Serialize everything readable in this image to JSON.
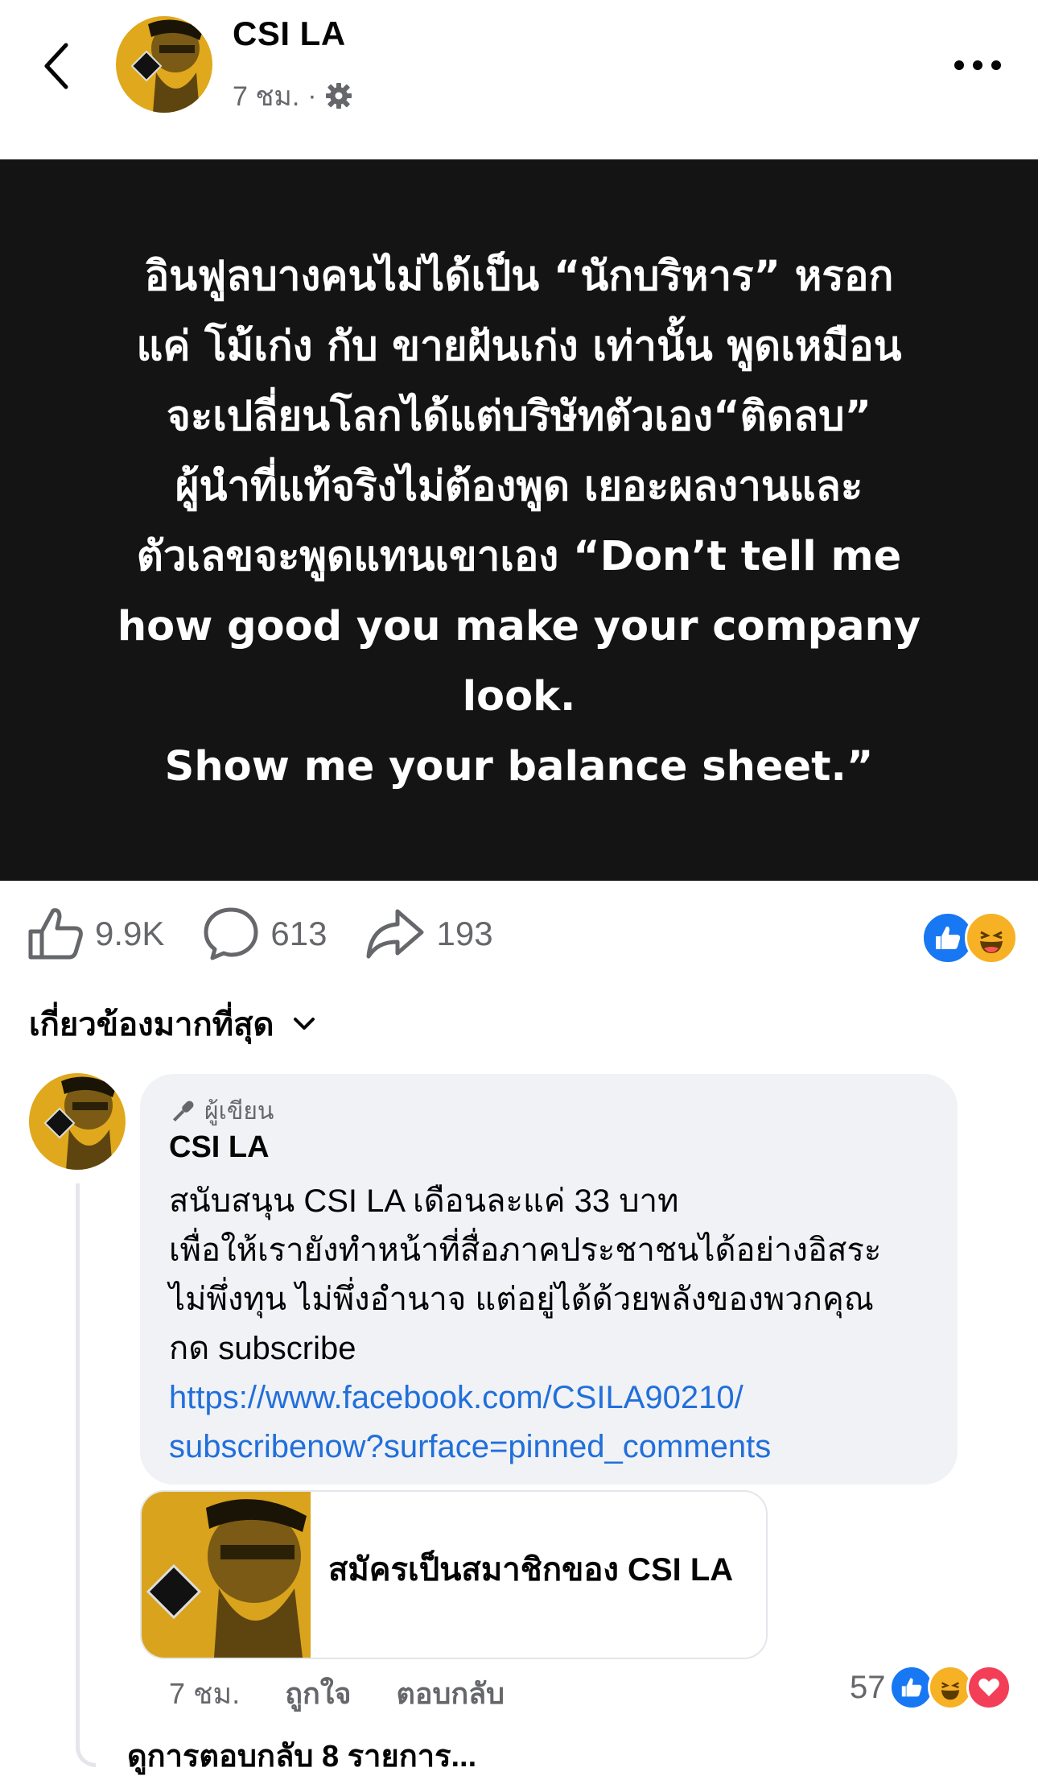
{
  "header": {
    "page_name": "CSI LA",
    "time_ago": "7 ชม.",
    "separator": "·"
  },
  "post": {
    "text": "อินฟูลบางคนไม่ได้เป็น “นักบริหาร” หรอก\nแค่ โม้เก่ง กับ ขายฝันเก่ง เท่านั้น พูดเหมือน\nจะเปลี่ยนโลกได้แต่บริษัทตัวเอง“ติดลบ”\nผู้นำที่แท้จริงไม่ต้องพูด เยอะผลงานและ\nตัวเลขจะพูดแทนเขาเอง “Don’t tell me\nhow good you make your company\nlook.\nShow me your balance sheet.”",
    "background": "#141414"
  },
  "actions": {
    "likes": "9.9K",
    "comments": "613",
    "shares": "193"
  },
  "sort": {
    "label": "เกี่ยวข้องมากที่สุด"
  },
  "comment": {
    "author_badge": "ผู้เขียน",
    "name": "CSI LA",
    "text": "สนับสนุน CSI LA เดือนละแค่ 33 บาท\nเพื่อให้เรายังทำหน้าที่สื่อภาคประชาชนได้อย่างอิสระ\nไม่พึ่งทุน ไม่พึ่งอำนาจ แต่อยู่ได้ด้วยพลังของพวกคุณ\nกด subscribe",
    "link": " https://www.facebook.com/CSILA90210/\nsubscribenow?surface=pinned_comments",
    "card_title": "สมัครเป็นสมาชิกของ CSI LA",
    "time": "7 ชม.",
    "like_label": "ถูกใจ",
    "reply_label": "ตอบกลับ",
    "reaction_count": "57",
    "view_replies": "ดูการตอบกลับ 8 รายการ..."
  },
  "colors": {
    "accent_blue": "#216fdb",
    "like_blue": "#1877f2",
    "love_red": "#f33e58",
    "haha_yellow": "#f7b125",
    "muted": "#65676b"
  }
}
